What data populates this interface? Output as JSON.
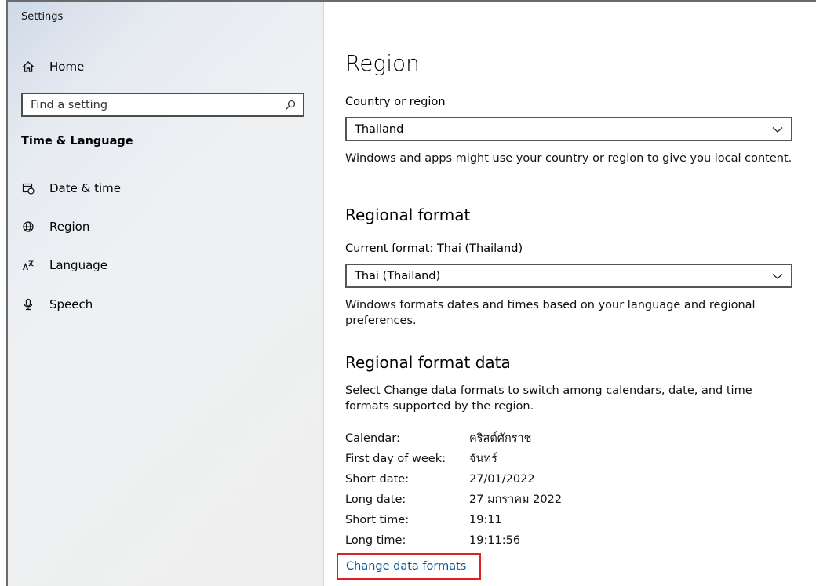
{
  "window": {
    "title": "Settings"
  },
  "sidebar": {
    "home_label": "Home",
    "search_placeholder": "Find a setting",
    "section_title": "Time & Language",
    "items": [
      {
        "label": "Date & time",
        "icon": "calendar-clock-icon"
      },
      {
        "label": "Region",
        "icon": "globe-icon"
      },
      {
        "label": "Language",
        "icon": "language-icon"
      },
      {
        "label": "Speech",
        "icon": "microphone-icon"
      }
    ]
  },
  "main": {
    "title": "Region",
    "country": {
      "label": "Country or region",
      "selected": "Thailand",
      "description": "Windows and apps might use your country or region to give you local content."
    },
    "regional_format": {
      "heading": "Regional format",
      "current_label": "Current format: Thai (Thailand)",
      "selected": "Thai (Thailand)",
      "description": "Windows formats dates and times based on your language and regional preferences."
    },
    "regional_format_data": {
      "heading": "Regional format data",
      "description": "Select Change data formats to switch among calendars, date, and time formats supported by the region.",
      "rows": [
        {
          "key": "Calendar:",
          "value": "คริสต์ศักราช"
        },
        {
          "key": "First day of week:",
          "value": "จันทร์"
        },
        {
          "key": "Short date:",
          "value": "27/01/2022"
        },
        {
          "key": "Long date:",
          "value": "27 มกราคม 2022"
        },
        {
          "key": "Short time:",
          "value": "19:11"
        },
        {
          "key": "Long time:",
          "value": "19:11:56"
        }
      ],
      "change_link": "Change data formats"
    }
  },
  "colors": {
    "link": "#0b5a8c",
    "highlight_border": "#e02020",
    "sidebar_bg": "#efefef"
  }
}
